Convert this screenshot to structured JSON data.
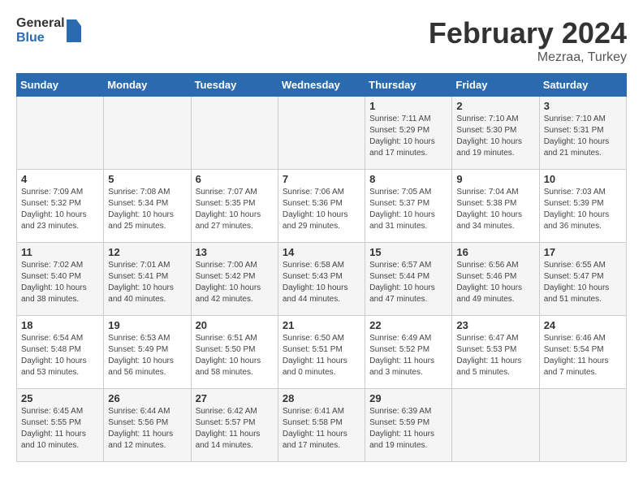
{
  "header": {
    "logo_general": "General",
    "logo_blue": "Blue",
    "month_year": "February 2024",
    "location": "Mezraa, Turkey"
  },
  "weekdays": [
    "Sunday",
    "Monday",
    "Tuesday",
    "Wednesday",
    "Thursday",
    "Friday",
    "Saturday"
  ],
  "weeks": [
    [
      {
        "day": "",
        "info": ""
      },
      {
        "day": "",
        "info": ""
      },
      {
        "day": "",
        "info": ""
      },
      {
        "day": "",
        "info": ""
      },
      {
        "day": "1",
        "info": "Sunrise: 7:11 AM\nSunset: 5:29 PM\nDaylight: 10 hours\nand 17 minutes."
      },
      {
        "day": "2",
        "info": "Sunrise: 7:10 AM\nSunset: 5:30 PM\nDaylight: 10 hours\nand 19 minutes."
      },
      {
        "day": "3",
        "info": "Sunrise: 7:10 AM\nSunset: 5:31 PM\nDaylight: 10 hours\nand 21 minutes."
      }
    ],
    [
      {
        "day": "4",
        "info": "Sunrise: 7:09 AM\nSunset: 5:32 PM\nDaylight: 10 hours\nand 23 minutes."
      },
      {
        "day": "5",
        "info": "Sunrise: 7:08 AM\nSunset: 5:34 PM\nDaylight: 10 hours\nand 25 minutes."
      },
      {
        "day": "6",
        "info": "Sunrise: 7:07 AM\nSunset: 5:35 PM\nDaylight: 10 hours\nand 27 minutes."
      },
      {
        "day": "7",
        "info": "Sunrise: 7:06 AM\nSunset: 5:36 PM\nDaylight: 10 hours\nand 29 minutes."
      },
      {
        "day": "8",
        "info": "Sunrise: 7:05 AM\nSunset: 5:37 PM\nDaylight: 10 hours\nand 31 minutes."
      },
      {
        "day": "9",
        "info": "Sunrise: 7:04 AM\nSunset: 5:38 PM\nDaylight: 10 hours\nand 34 minutes."
      },
      {
        "day": "10",
        "info": "Sunrise: 7:03 AM\nSunset: 5:39 PM\nDaylight: 10 hours\nand 36 minutes."
      }
    ],
    [
      {
        "day": "11",
        "info": "Sunrise: 7:02 AM\nSunset: 5:40 PM\nDaylight: 10 hours\nand 38 minutes."
      },
      {
        "day": "12",
        "info": "Sunrise: 7:01 AM\nSunset: 5:41 PM\nDaylight: 10 hours\nand 40 minutes."
      },
      {
        "day": "13",
        "info": "Sunrise: 7:00 AM\nSunset: 5:42 PM\nDaylight: 10 hours\nand 42 minutes."
      },
      {
        "day": "14",
        "info": "Sunrise: 6:58 AM\nSunset: 5:43 PM\nDaylight: 10 hours\nand 44 minutes."
      },
      {
        "day": "15",
        "info": "Sunrise: 6:57 AM\nSunset: 5:44 PM\nDaylight: 10 hours\nand 47 minutes."
      },
      {
        "day": "16",
        "info": "Sunrise: 6:56 AM\nSunset: 5:46 PM\nDaylight: 10 hours\nand 49 minutes."
      },
      {
        "day": "17",
        "info": "Sunrise: 6:55 AM\nSunset: 5:47 PM\nDaylight: 10 hours\nand 51 minutes."
      }
    ],
    [
      {
        "day": "18",
        "info": "Sunrise: 6:54 AM\nSunset: 5:48 PM\nDaylight: 10 hours\nand 53 minutes."
      },
      {
        "day": "19",
        "info": "Sunrise: 6:53 AM\nSunset: 5:49 PM\nDaylight: 10 hours\nand 56 minutes."
      },
      {
        "day": "20",
        "info": "Sunrise: 6:51 AM\nSunset: 5:50 PM\nDaylight: 10 hours\nand 58 minutes."
      },
      {
        "day": "21",
        "info": "Sunrise: 6:50 AM\nSunset: 5:51 PM\nDaylight: 11 hours\nand 0 minutes."
      },
      {
        "day": "22",
        "info": "Sunrise: 6:49 AM\nSunset: 5:52 PM\nDaylight: 11 hours\nand 3 minutes."
      },
      {
        "day": "23",
        "info": "Sunrise: 6:47 AM\nSunset: 5:53 PM\nDaylight: 11 hours\nand 5 minutes."
      },
      {
        "day": "24",
        "info": "Sunrise: 6:46 AM\nSunset: 5:54 PM\nDaylight: 11 hours\nand 7 minutes."
      }
    ],
    [
      {
        "day": "25",
        "info": "Sunrise: 6:45 AM\nSunset: 5:55 PM\nDaylight: 11 hours\nand 10 minutes."
      },
      {
        "day": "26",
        "info": "Sunrise: 6:44 AM\nSunset: 5:56 PM\nDaylight: 11 hours\nand 12 minutes."
      },
      {
        "day": "27",
        "info": "Sunrise: 6:42 AM\nSunset: 5:57 PM\nDaylight: 11 hours\nand 14 minutes."
      },
      {
        "day": "28",
        "info": "Sunrise: 6:41 AM\nSunset: 5:58 PM\nDaylight: 11 hours\nand 17 minutes."
      },
      {
        "day": "29",
        "info": "Sunrise: 6:39 AM\nSunset: 5:59 PM\nDaylight: 11 hours\nand 19 minutes."
      },
      {
        "day": "",
        "info": ""
      },
      {
        "day": "",
        "info": ""
      }
    ]
  ]
}
